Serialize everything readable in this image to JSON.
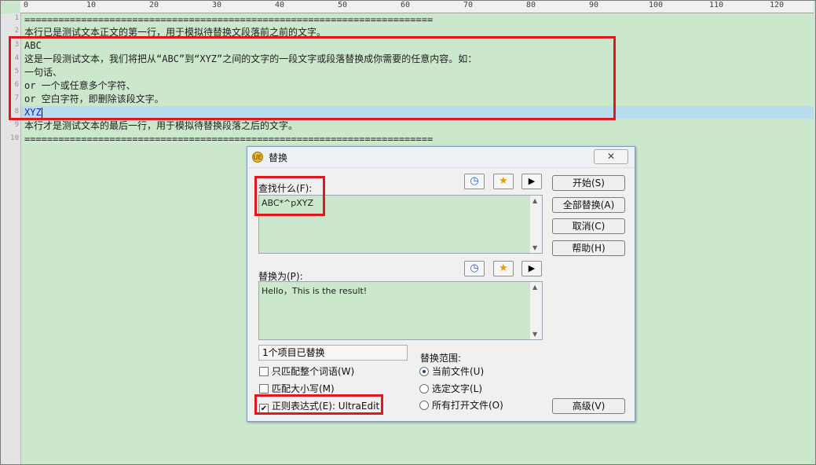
{
  "ruler": {
    "ticks": [
      "0",
      "10",
      "20",
      "30",
      "40",
      "50",
      "60",
      "70",
      "80",
      "90",
      "100",
      "110",
      "120"
    ]
  },
  "editor": {
    "line_numbers": [
      "1",
      "2",
      "3",
      "4",
      "5",
      "6",
      "7",
      "8",
      "9",
      "10"
    ],
    "lines": [
      "========================================================================",
      "本行已是测试文本正文的第一行，用于模拟待替换文段落前之前的文字。",
      "ABC",
      "这是一段测试文本，我们将把从“ABC”到“XYZ”之间的文字的一段文字或段落替换成你需要的任意内容。如：",
      "一句话、",
      "or 一个或任意多个字符、",
      "or 空白字符，即删除该段文字。",
      "XYZ",
      "本行才是测试文本的最后一行，用于模拟待替换段落之后的文字。",
      "========================================================================"
    ]
  },
  "dialog": {
    "title": "替换",
    "close_label": "✕",
    "find_label": "查找什么(F):",
    "find_value": "ABC*^pXYZ",
    "replace_label": "替换为(P):",
    "replace_value": "Hello，This is the result!",
    "buttons": {
      "start": "开始(S)",
      "replace_all": "全部替换(A)",
      "cancel": "取消(C)",
      "help": "帮助(H)",
      "advanced": "高级(V)"
    },
    "status": "1个项目已替换",
    "options": {
      "whole_word": "只匹配整个词语(W)",
      "match_case": "匹配大小写(M)",
      "regex": "正则表达式(E): UltraEdit"
    },
    "scope": {
      "title": "替换范围:",
      "current_file": "当前文件(U)",
      "selection": "选定文字(L)",
      "all_open": "所有打开文件(O)"
    }
  },
  "colors": {
    "editor_bg": "#cce8cc",
    "highlight": "#e0191f",
    "current_line": "#b7dcee"
  }
}
